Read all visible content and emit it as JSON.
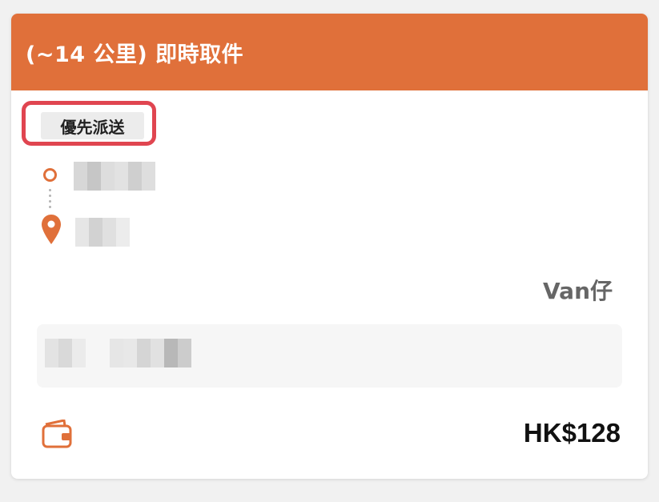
{
  "order": {
    "title": "(~14 公里) 即時取件",
    "priority_label": "優先派送",
    "vehicle": "Van仔",
    "price": "HK$128"
  },
  "colors": {
    "accent": "#e0703a",
    "highlight_border": "#e04550",
    "badge_bg": "#ececec"
  },
  "icons": {
    "origin": "origin-circle-icon",
    "destination": "location-pin-icon",
    "payment": "wallet-icon"
  }
}
